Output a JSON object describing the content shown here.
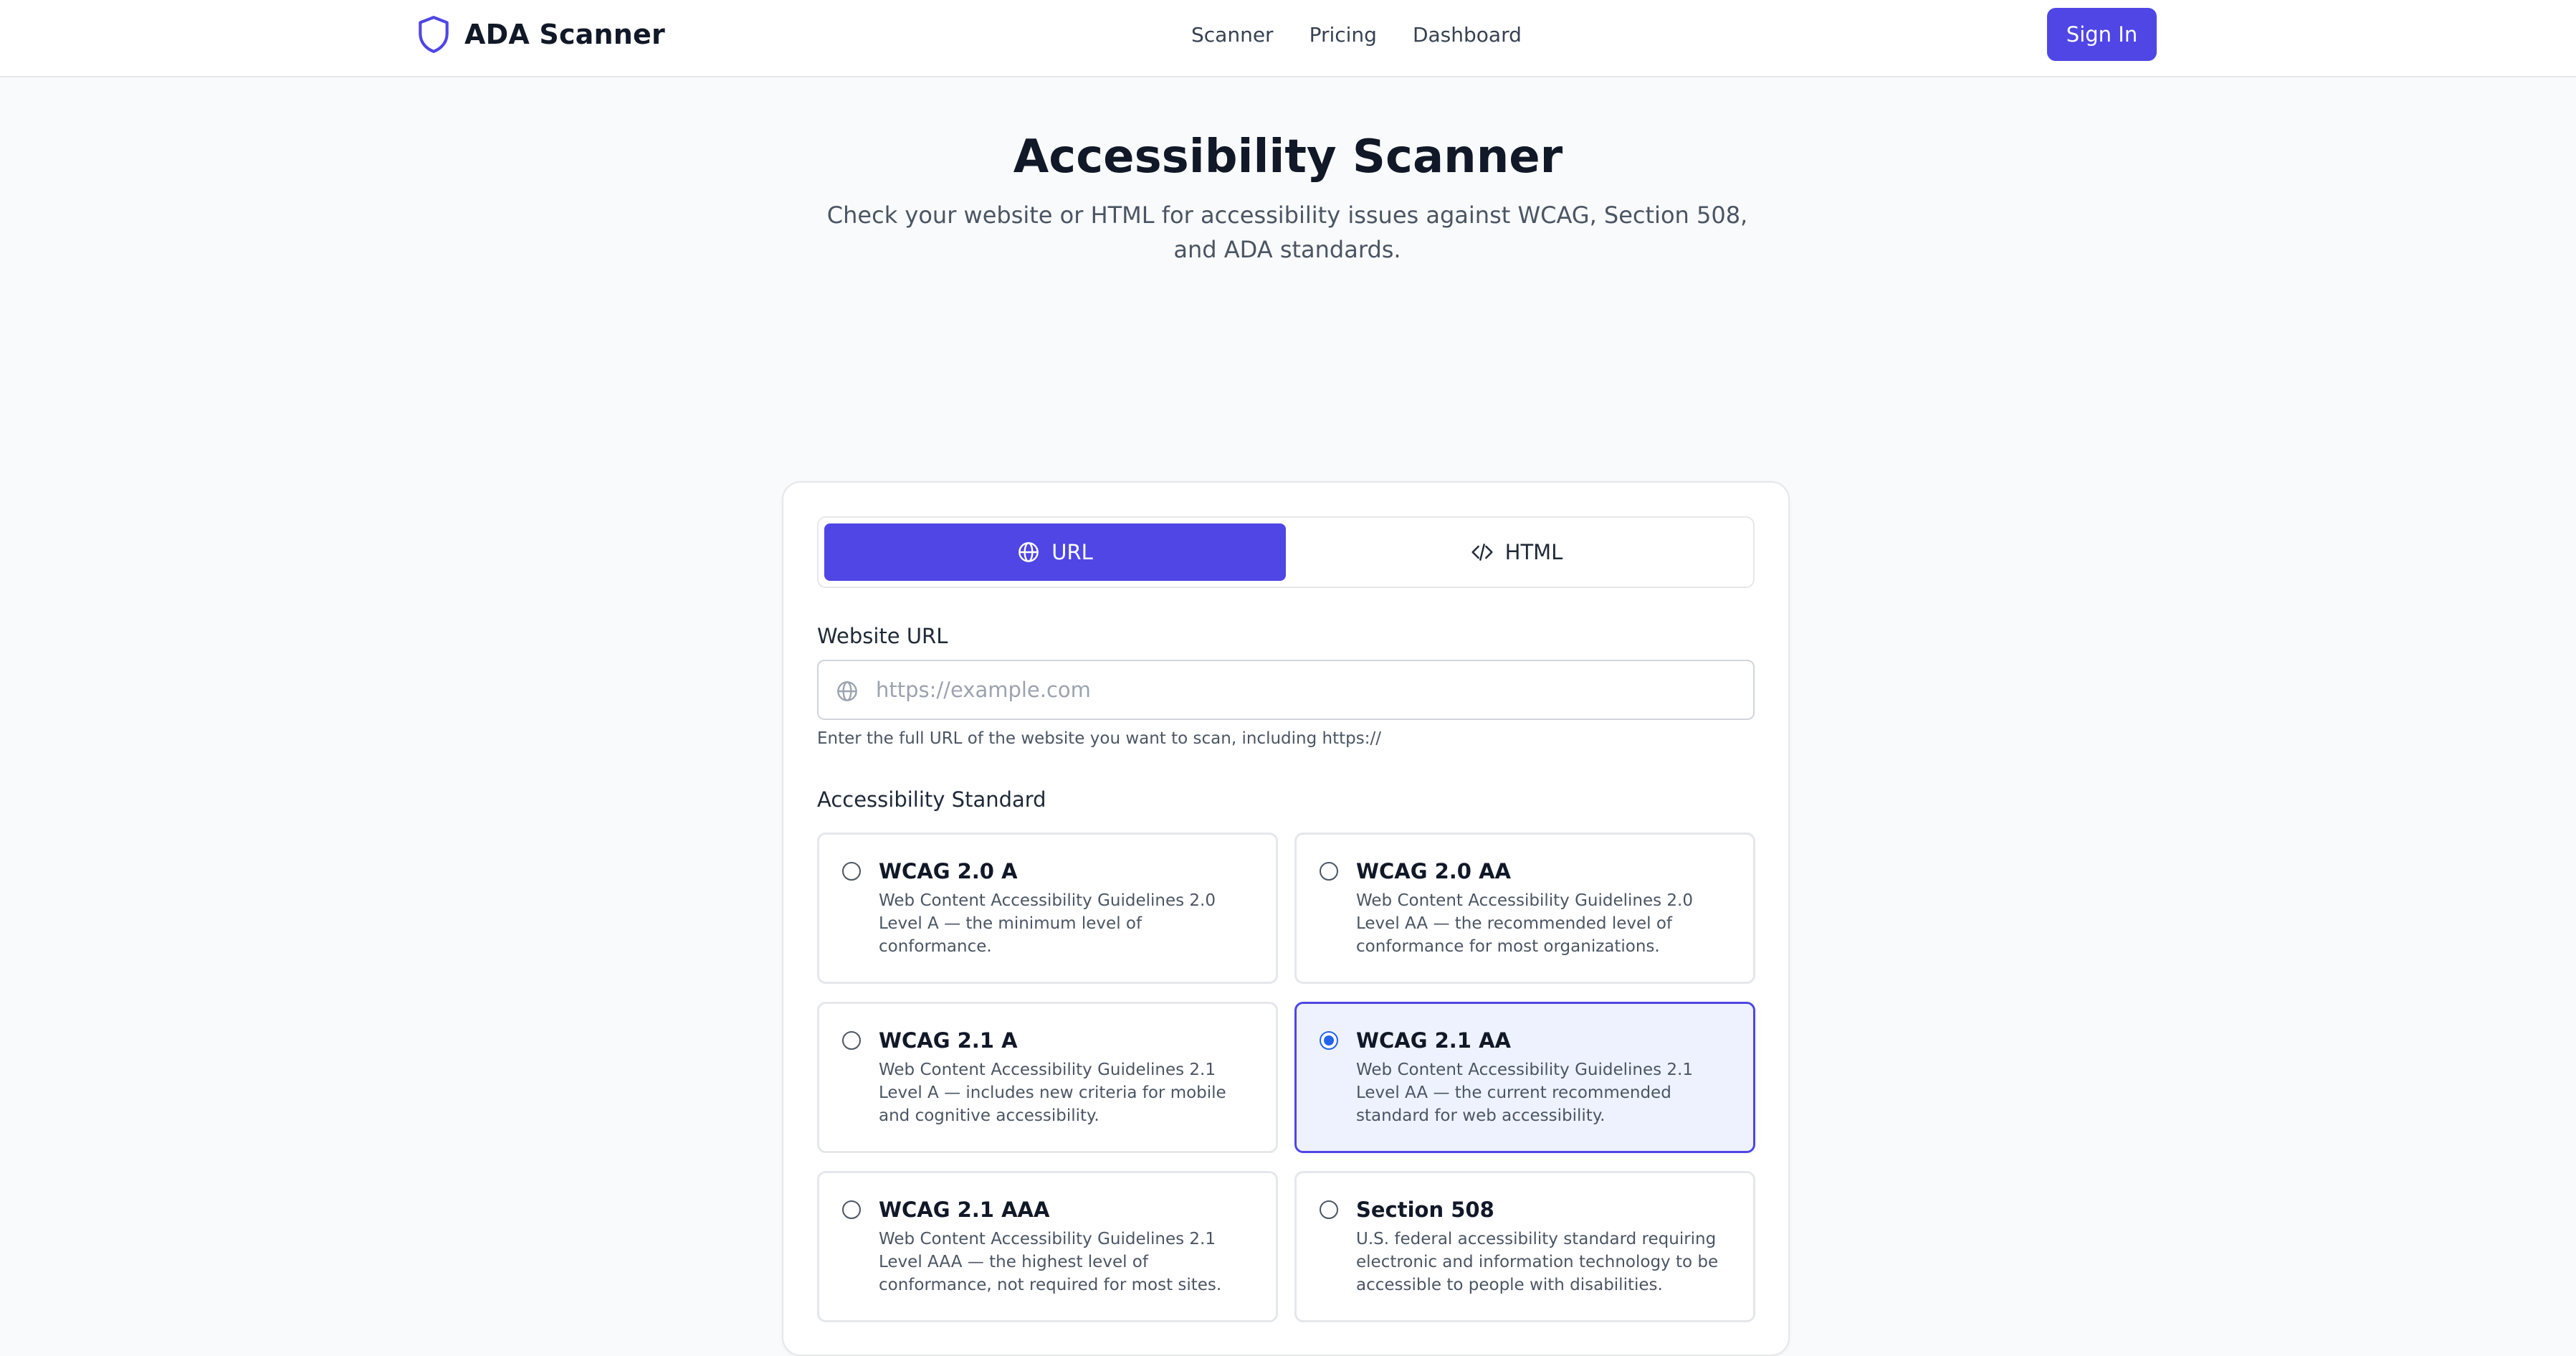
{
  "header": {
    "brand": "ADA Scanner",
    "logo_icon": "shield-icon",
    "nav": [
      "Scanner",
      "Pricing",
      "Dashboard"
    ],
    "sign_in": "Sign In",
    "accent": "#4f46e5"
  },
  "hero": {
    "title": "Accessibility Scanner",
    "subtitle": "Check your website or HTML for accessibility issues against WCAG, Section 508, and ADA standards."
  },
  "form": {
    "tabs": [
      {
        "label": "URL",
        "icon": "globe-icon",
        "active": true
      },
      {
        "label": "HTML",
        "icon": "code-icon",
        "active": false
      }
    ],
    "url_label": "Website URL",
    "url_value": "",
    "url_placeholder": "https://example.com",
    "url_hint": "Enter the full URL of the website you want to scan, including https://",
    "standard_label": "Accessibility Standard",
    "standards": [
      {
        "title": "WCAG 2.0 A",
        "desc": "Web Content Accessibility Guidelines 2.0 Level A — the minimum level of conformance.",
        "selected": false
      },
      {
        "title": "WCAG 2.0 AA",
        "desc": "Web Content Accessibility Guidelines 2.0 Level AA — the recommended level of conformance for most organizations.",
        "selected": false
      },
      {
        "title": "WCAG 2.1 A",
        "desc": "Web Content Accessibility Guidelines 2.1 Level A — includes new criteria for mobile and cognitive accessibility.",
        "selected": false
      },
      {
        "title": "WCAG 2.1 AA",
        "desc": "Web Content Accessibility Guidelines 2.1 Level AA — the current recommended standard for web accessibility.",
        "selected": true
      },
      {
        "title": "WCAG 2.1 AAA",
        "desc": "Web Content Accessibility Guidelines 2.1 Level AAA — the highest level of conformance, not required for most sites.",
        "selected": false
      },
      {
        "title": "Section 508",
        "desc": "U.S. federal accessibility standard requiring electronic and information technology to be accessible to people with disabilities.",
        "selected": false
      }
    ]
  }
}
